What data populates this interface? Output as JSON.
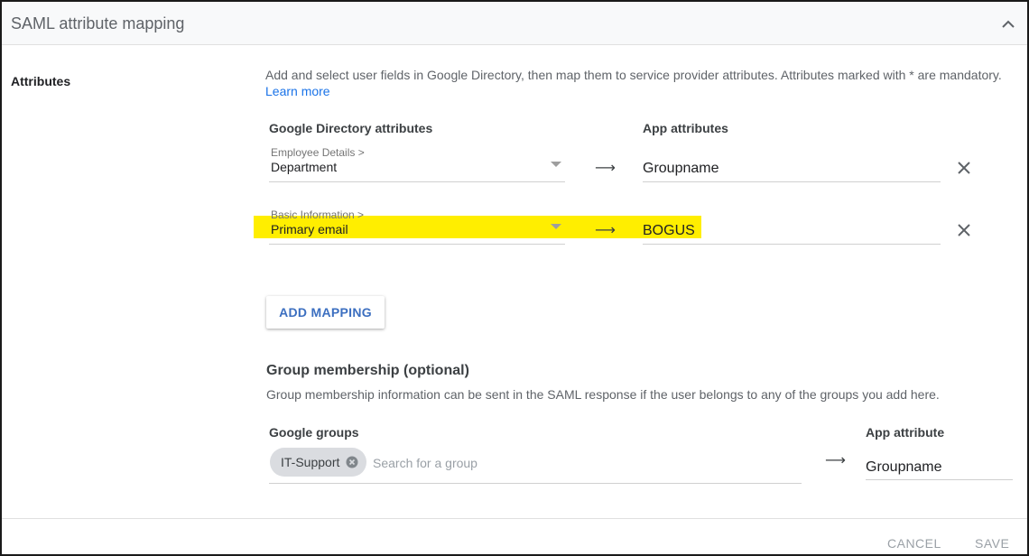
{
  "header": {
    "title": "SAML attribute mapping",
    "collapse_icon": "chevron-up-icon"
  },
  "attributes": {
    "section_label": "Attributes",
    "description": "Add and select user fields in Google Directory, then map them to service provider attributes. Attributes marked with * are mandatory.",
    "learn_more": "Learn more",
    "col_directory": "Google Directory attributes",
    "col_app": "App attributes",
    "mappings": [
      {
        "category": "Employee Details >",
        "field": "Department",
        "app_attribute": "Groupname",
        "highlighted": false
      },
      {
        "category": "Basic Information >",
        "field": "Primary email",
        "app_attribute": "BOGUS",
        "highlighted": true
      }
    ],
    "arrow": "⟶",
    "add_mapping_label": "ADD MAPPING",
    "highlight_color": "#ffee00"
  },
  "group_membership": {
    "title": "Group membership (optional)",
    "description": "Group membership information can be sent in the SAML response if the user belongs to any of the groups you add here.",
    "col_groups": "Google groups",
    "col_app_attribute": "App attribute",
    "chips": [
      {
        "label": "IT-Support"
      }
    ],
    "search_placeholder": "Search for a group",
    "app_attribute_value": "Groupname"
  },
  "footer": {
    "cancel_label": "CANCEL",
    "save_label": "SAVE"
  },
  "colors": {
    "link": "#1a73e8",
    "button_text": "#3c6fc0",
    "header_bg": "#f8f9fa"
  }
}
